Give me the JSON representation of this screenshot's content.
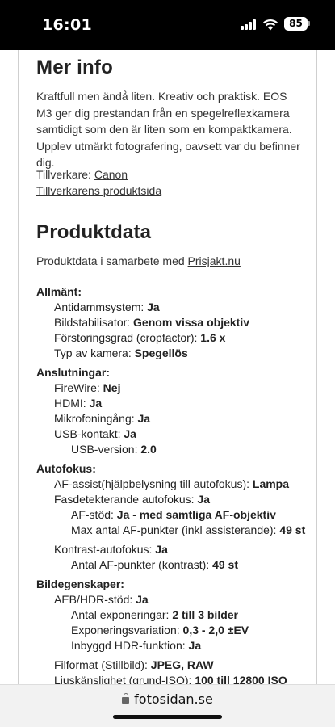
{
  "status_bar": {
    "time": "16:01",
    "battery": "85"
  },
  "more_info": {
    "heading": "Mer info",
    "description": "Kraftfull men ändå liten. Kreativ och praktisk. EOS M3 ger dig prestandan från en spegelreflexkamera samtidigt som den är liten som en kompaktkamera. Upplev utmärkt fotografering, oavsett var du befinner dig.",
    "manufacturer_label": "Tillverkare:",
    "manufacturer_link": "Canon",
    "manufacturer_page_link": "Tillverkarens produktsida"
  },
  "product_data": {
    "heading": "Produktdata",
    "collab_text": "Produktdata i samarbete med",
    "collab_link": "Prisjakt.nu",
    "specs": [
      {
        "label": "Allmänt:",
        "value": ""
      },
      {
        "label": "Antidammsystem:",
        "value": "Ja"
      },
      {
        "label": "Bildstabilisator:",
        "value": "Genom vissa objektiv"
      },
      {
        "label": "Förstoringsgrad (cropfactor):",
        "value": "1.6 x"
      },
      {
        "label": "Typ av kamera:",
        "value": "Spegellös"
      },
      {
        "label": "Anslutningar:",
        "value": ""
      },
      {
        "label": "FireWire:",
        "value": "Nej"
      },
      {
        "label": "HDMI:",
        "value": "Ja"
      },
      {
        "label": "Mikrofoningång:",
        "value": "Ja"
      },
      {
        "label": "USB-kontakt:",
        "value": "Ja"
      },
      {
        "label": "USB-version:",
        "value": "2.0"
      },
      {
        "label": "Autofokus:",
        "value": ""
      },
      {
        "label": "AF-assist(hjälpbelysning till autofokus):",
        "value": "Lampa"
      },
      {
        "label": "Fasdetekterande autofokus:",
        "value": "Ja"
      },
      {
        "label": "AF-stöd:",
        "value": "Ja - med samtliga AF-objektiv"
      },
      {
        "label": "Max antal AF-punkter (inkl assisterande):",
        "value": "49 st"
      },
      {
        "label": "Kontrast-autofokus:",
        "value": "Ja"
      },
      {
        "label": "Antal AF-punkter (kontrast):",
        "value": "49 st"
      },
      {
        "label": "Bildegenskaper:",
        "value": ""
      },
      {
        "label": "AEB/HDR-stöd:",
        "value": "Ja"
      },
      {
        "label": "Antal exponeringar:",
        "value": "2 till 3 bilder"
      },
      {
        "label": "Exponeringsvariation:",
        "value": "0,3 - 2,0 ±EV"
      },
      {
        "label": "Inbyggd HDR-funktion:",
        "value": "Ja"
      },
      {
        "label": "Filformat (Stillbild):",
        "value": "JPEG, RAW"
      },
      {
        "label": "Ljuskänslighet (grund-ISO):",
        "value": "100 till 12800 ISO"
      }
    ]
  },
  "url_bar": {
    "domain": "fotosidan.se"
  }
}
